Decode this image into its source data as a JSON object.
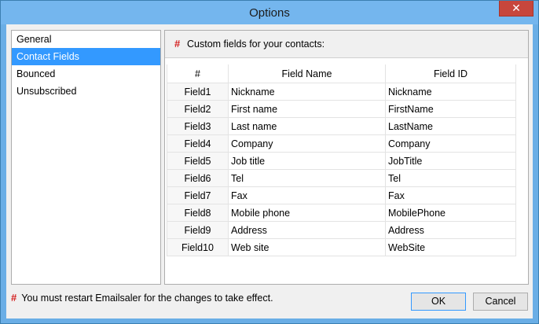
{
  "window": {
    "title": "Options",
    "close_glyph": "✕"
  },
  "nav": {
    "items": [
      {
        "label": "General",
        "selected": false
      },
      {
        "label": "Contact Fields",
        "selected": true
      },
      {
        "label": "Bounced",
        "selected": false
      },
      {
        "label": "Unsubscribed",
        "selected": false
      }
    ]
  },
  "panel": {
    "marker": "#",
    "caption": "Custom fields for your contacts:",
    "table": {
      "columns": [
        "#",
        "Field Name",
        "Field ID"
      ],
      "rows": [
        [
          "Field1",
          "Nickname",
          "Nickname"
        ],
        [
          "Field2",
          "First name",
          "FirstName"
        ],
        [
          "Field3",
          "Last name",
          "LastName"
        ],
        [
          "Field4",
          "Company",
          "Company"
        ],
        [
          "Field5",
          "Job title",
          "JobTitle"
        ],
        [
          "Field6",
          "Tel",
          "Tel"
        ],
        [
          "Field7",
          "Fax",
          "Fax"
        ],
        [
          "Field8",
          "Mobile phone",
          "MobilePhone"
        ],
        [
          "Field9",
          "Address",
          "Address"
        ],
        [
          "Field10",
          "Web site",
          "WebSite"
        ]
      ]
    }
  },
  "footer": {
    "marker": "#",
    "note": "You must restart Emailsaler for the changes to take effect.",
    "ok_label": "OK",
    "cancel_label": "Cancel"
  }
}
